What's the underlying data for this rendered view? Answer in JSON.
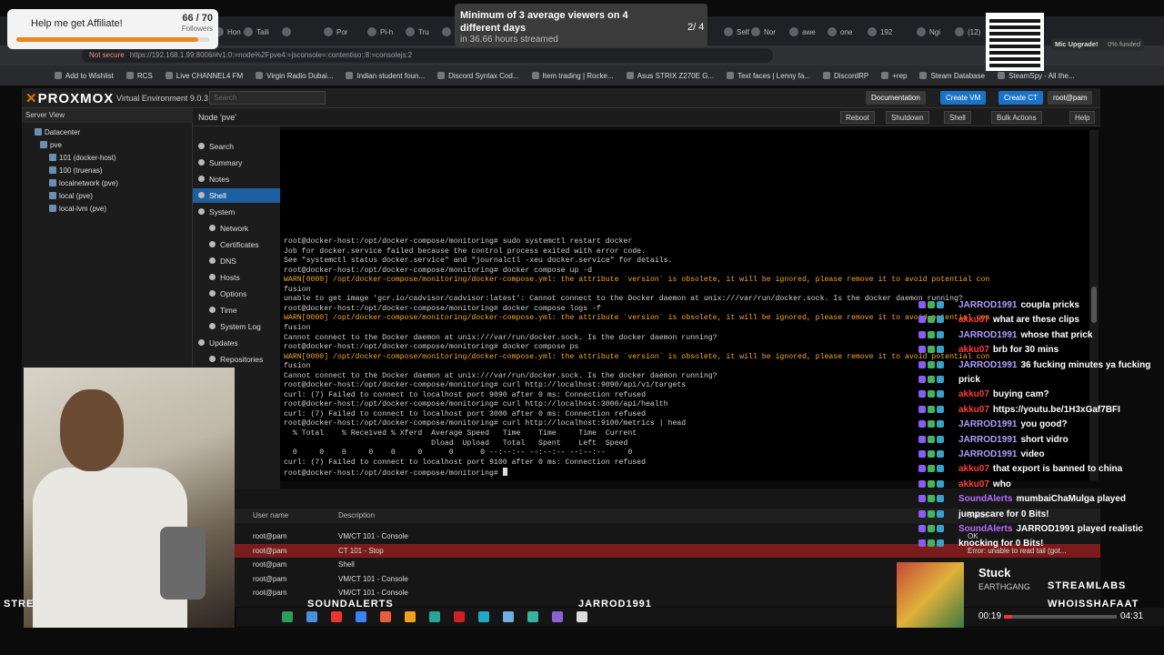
{
  "browser": {
    "tabs": [
      "Hon",
      "Taili",
      "",
      "Por",
      "Pi-h",
      "Tru",
      "",
      "Self",
      "Nor",
      "awe",
      "one",
      "192",
      "Ngi",
      "(12)"
    ],
    "url_security": "Not secure",
    "url": "https://192.168.1.99:8006/#v1:0:=node%2Fpve4:=jsconsole=:contentiso::8:=consolejs:2",
    "bookmarks": [
      "Add to Wishlist",
      "RCS",
      "Live CHANNEL4 FM",
      "Virgin Radio Dubai...",
      "Indian student foun...",
      "Discord Syntax Cod...",
      "Item trading | Rocke...",
      "Asus STRIX Z270E G...",
      "Text faces | Lenny fa...",
      "DiscordRP",
      "+rep",
      "Steam Database",
      "SteamSpy - All the..."
    ]
  },
  "proxmox": {
    "logo_x": "✕",
    "logo_brand": "PROXMOX",
    "version": "Virtual Environment 9.0.3",
    "search_placeholder": "Search",
    "buttons": {
      "documentation": "Documentation",
      "create_vm": "Create VM",
      "create_ct": "Create CT",
      "user": "root@pam",
      "help": "Help"
    },
    "tree_header": "Server View",
    "tree": [
      "Datacenter",
      "pve",
      "101 (docker-host)",
      "100 (truenas)",
      "localnetwork (pve)",
      "local (pve)",
      "local-lvm (pve)"
    ],
    "node_title": "Node 'pve'",
    "node_buttons": [
      "Reboot",
      "Shutdown",
      "Shell",
      "Bulk Actions",
      "Help"
    ],
    "menu": [
      "Search",
      "Summary",
      "Notes",
      "Shell",
      "System",
      "Network",
      "Certificates",
      "DNS",
      "Hosts",
      "Options",
      "Time",
      "System Log",
      "Updates",
      "Repositories"
    ],
    "terminal": [
      {
        "t": "root@docker-host:/opt/docker-compose/monitoring# sudo systemctl restart docker",
        "w": false
      },
      {
        "t": "Job for docker.service failed because the control process exited with error code.",
        "w": false
      },
      {
        "t": "See \"systemctl status docker.service\" and \"journalctl -xeu docker.service\" for details.",
        "w": false
      },
      {
        "t": "root@docker-host:/opt/docker-compose/monitoring# docker compose up -d",
        "w": false
      },
      {
        "t": "WARN[0000] /opt/docker-compose/monitoring/docker-compose.yml: the attribute `version` is obsolete, it will be ignored, please remove it to avoid potential con",
        "w": true
      },
      {
        "t": "fusion",
        "w": false
      },
      {
        "t": "unable to get image 'gcr.io/cadvisor/cadvisor:latest': Cannot connect to the Docker daemon at unix:///var/run/docker.sock. Is the docker daemon running?",
        "w": false
      },
      {
        "t": "root@docker-host:/opt/docker-compose/monitoring# docker compose logs -f",
        "w": false
      },
      {
        "t": "WARN[0000] /opt/docker-compose/monitoring/docker-compose.yml: the attribute `version` is obsolete, it will be ignored, please remove it to avoid potential con",
        "w": true
      },
      {
        "t": "fusion",
        "w": false
      },
      {
        "t": "Cannot connect to the Docker daemon at unix:///var/run/docker.sock. Is the docker daemon running?",
        "w": false
      },
      {
        "t": "root@docker-host:/opt/docker-compose/monitoring# docker compose ps",
        "w": false
      },
      {
        "t": "WARN[0000] /opt/docker-compose/monitoring/docker-compose.yml: the attribute `version` is obsolete, it will be ignored, please remove it to avoid potential con",
        "w": true
      },
      {
        "t": "fusion",
        "w": false
      },
      {
        "t": "Cannot connect to the Docker daemon at unix:///var/run/docker.sock. Is the docker daemon running?",
        "w": false
      },
      {
        "t": "root@docker-host:/opt/docker-compose/monitoring# curl http://localhost:9090/api/v1/targets",
        "w": false
      },
      {
        "t": "curl: (7) Failed to connect to localhost port 9090 after 0 ms: Connection refused",
        "w": false
      },
      {
        "t": "root@docker-host:/opt/docker-compose/monitoring# curl http://localhost:3000/api/health",
        "w": false
      },
      {
        "t": "curl: (7) Failed to connect to localhost port 3000 after 0 ms: Connection refused",
        "w": false
      },
      {
        "t": "root@docker-host:/opt/docker-compose/monitoring# curl http://localhost:9100/metrics | head",
        "w": false
      },
      {
        "t": "  % Total    % Received % Xferd  Average Speed   Time    Time     Time  Current",
        "w": false
      },
      {
        "t": "                                 Dload  Upload   Total   Spent    Left  Speed",
        "w": false
      },
      {
        "t": "  0     0    0     0    0     0      0      0 --:--:-- --:--:-- --:--:--     0",
        "w": false
      },
      {
        "t": "curl: (7) Failed to connect to localhost port 9100 after 0 ms: Connection refused",
        "w": false
      }
    ],
    "prompt": "root@docker-host:/opt/docker-compose/monitoring# ",
    "tasks_header": {
      "user": "User name",
      "desc": "Description",
      "status": "Status"
    },
    "tasks": [
      {
        "user": "root@pam",
        "desc": "VM/CT 101 - Console",
        "status": "OK",
        "err": false
      },
      {
        "user": "root@pam",
        "desc": "CT 101 - Stop",
        "status": "Error: unable to read tail (got...",
        "err": true
      },
      {
        "user": "root@pam",
        "desc": "Shell",
        "status": "",
        "err": false
      },
      {
        "user": "root@pam",
        "desc": "VM/CT 101 - Console",
        "status": "",
        "err": false
      },
      {
        "user": "root@pam",
        "desc": "VM/CT 101 - Console",
        "status": "",
        "err": false
      }
    ]
  },
  "overlay": {
    "affiliate_label": "Help me get Affiliate!",
    "affiliate_count": "66 / 70",
    "affiliate_followers": "Followers",
    "affiliate_progress": 0.943,
    "goal_text": "Minimum of 3 average viewers on 4 different days",
    "goal_sub": "in 36.66 hours streamed",
    "goal_counter": "2/ 4",
    "mic_label": "Mic Upgrade!",
    "mic_funded": "0% funded",
    "chat": [
      {
        "user": "JARROD1991",
        "text": "coupla pricks",
        "color": "#b19cff"
      },
      {
        "user": "akku07",
        "text": "what are these clips",
        "color": "#ff3b3b"
      },
      {
        "user": "JARROD1991",
        "text": "whose that prick",
        "color": "#b19cff"
      },
      {
        "user": "akku07",
        "text": "brb for 30 mins",
        "color": "#ff3b3b"
      },
      {
        "user": "JARROD1991",
        "text": "36 fucking minutes ya fucking",
        "color": "#b19cff"
      },
      {
        "user": "",
        "text": "prick",
        "color": "#b19cff"
      },
      {
        "user": "akku07",
        "text": "buying cam?",
        "color": "#ff3b3b"
      },
      {
        "user": "akku07",
        "text": "https://youtu.be/1H3xGaf7BFI",
        "color": "#ff3b3b"
      },
      {
        "user": "JARROD1991",
        "text": "you good?",
        "color": "#b19cff"
      },
      {
        "user": "JARROD1991",
        "text": "short vidro",
        "color": "#b19cff"
      },
      {
        "user": "JARROD1991",
        "text": "video",
        "color": "#b19cff"
      },
      {
        "user": "akku07",
        "text": "that export is banned to china",
        "color": "#ff3b3b"
      },
      {
        "user": "akku07",
        "text": "who",
        "color": "#ff3b3b"
      },
      {
        "user": "SoundAlerts",
        "text": "mumbaiChaMulga played",
        "color": "#b96cff"
      },
      {
        "user": "",
        "text": "jumpscare for 0 Bits!",
        "color": "#b96cff"
      },
      {
        "user": "SoundAlerts",
        "text": "JARROD1991 played realistic",
        "color": "#b96cff"
      },
      {
        "user": "",
        "text": "knocking for 0 Bits!",
        "color": "#b96cff"
      }
    ],
    "song": "Stuck",
    "artist": "EARTHGANG",
    "time_current": "00:19",
    "time_total": "04:31",
    "song_progress": 0.07,
    "streamlabs": "STREAMLABS",
    "whoisshafaat": "WHOISSHAFAAT",
    "alerts": [
      "STRE",
      "SOUNDALERTS",
      "JARROD1991"
    ],
    "colors": {
      "proxmox_orange": "#e57000",
      "selected_blue": "#1d5fa0",
      "error_red": "#7a1c1c",
      "warn_orange": "#f5a623"
    }
  }
}
